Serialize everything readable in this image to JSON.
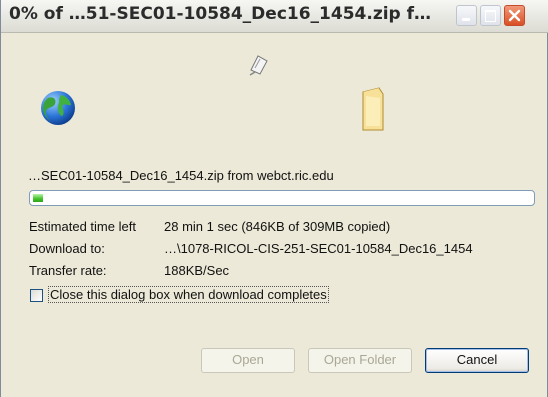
{
  "window": {
    "title": "0% of …51-SEC01-10584_Dec16_1454.zip f…",
    "controls": [
      "minimize-icon",
      "maximize-icon",
      "close-icon"
    ]
  },
  "icons": {
    "animation": "paper-flying-icon",
    "source": "globe-icon",
    "destination": "folder-icon"
  },
  "download": {
    "file_line": "…SEC01-10584_Dec16_1454.zip from webct.ric.edu",
    "progress_fraction": 0.02,
    "estimated_label": "Estimated time left",
    "estimated_value": "28 min 1 sec (846KB of 309MB copied)",
    "download_to_label": "Download to:",
    "download_to_value": "…\\1078-RICOL-CIS-251-SEC01-10584_Dec16_1454",
    "transfer_label": "Transfer rate:",
    "transfer_value": "188KB/Sec"
  },
  "options": {
    "close_when_done_label": "Close this dialog box when download completes",
    "close_when_done_checked": false
  },
  "buttons": {
    "open": "Open",
    "open_folder": "Open Folder",
    "cancel": "Cancel"
  },
  "colors": {
    "progress": "#44c229",
    "dialog_bg": "#ece9d8"
  }
}
